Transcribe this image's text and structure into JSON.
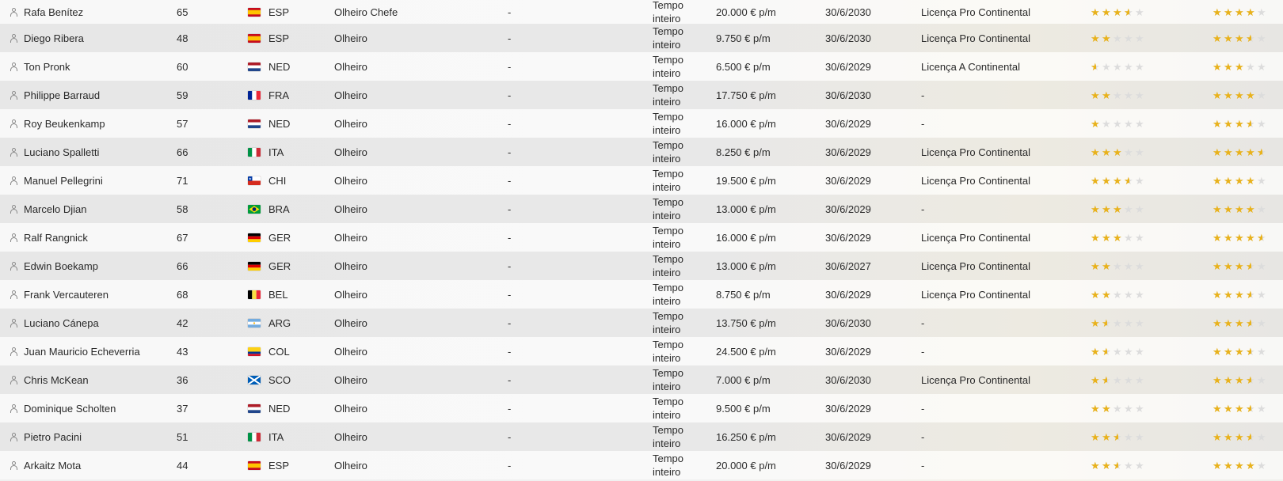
{
  "colors": {
    "star_full": "#e9b21b",
    "star_empty": "#dcdcdc",
    "text": "#2a2a2a"
  },
  "icons": {
    "row_icon": "person-icon",
    "rating_icon": "star-icon"
  },
  "staff": [
    {
      "name": "Rafa Benítez",
      "age": "65",
      "flag": "ESP",
      "nation": "ESP",
      "role": "Olheiro Chefe",
      "extra": "-",
      "contract_line1": "Tempo",
      "contract_line2": "inteiro",
      "wage": "20.000 € p/m",
      "expiry": "30/6/2030",
      "license": "Licença Pro Continental",
      "current_ability": 3.5,
      "potential_ability": 4
    },
    {
      "name": "Diego Ribera",
      "age": "48",
      "flag": "ESP",
      "nation": "ESP",
      "role": "Olheiro",
      "extra": "-",
      "contract_line1": "Tempo",
      "contract_line2": "inteiro",
      "wage": "9.750 € p/m",
      "expiry": "30/6/2030",
      "license": "Licença Pro Continental",
      "current_ability": 2,
      "potential_ability": 3.5
    },
    {
      "name": "Ton Pronk",
      "age": "60",
      "flag": "NED",
      "nation": "NED",
      "role": "Olheiro",
      "extra": "-",
      "contract_line1": "Tempo",
      "contract_line2": "inteiro",
      "wage": "6.500 € p/m",
      "expiry": "30/6/2029",
      "license": "Licença A Continental",
      "current_ability": 0.5,
      "potential_ability": 3
    },
    {
      "name": "Philippe Barraud",
      "age": "59",
      "flag": "FRA",
      "nation": "FRA",
      "role": "Olheiro",
      "extra": "-",
      "contract_line1": "Tempo",
      "contract_line2": "inteiro",
      "wage": "17.750 € p/m",
      "expiry": "30/6/2030",
      "license": "-",
      "current_ability": 2,
      "potential_ability": 4
    },
    {
      "name": "Roy Beukenkamp",
      "age": "57",
      "flag": "NED",
      "nation": "NED",
      "role": "Olheiro",
      "extra": "-",
      "contract_line1": "Tempo",
      "contract_line2": "inteiro",
      "wage": "16.000 € p/m",
      "expiry": "30/6/2029",
      "license": "-",
      "current_ability": 1,
      "potential_ability": 3.5
    },
    {
      "name": "Luciano Spalletti",
      "age": "66",
      "flag": "ITA",
      "nation": "ITA",
      "role": "Olheiro",
      "extra": "-",
      "contract_line1": "Tempo",
      "contract_line2": "inteiro",
      "wage": "8.250 € p/m",
      "expiry": "30/6/2029",
      "license": "Licença Pro Continental",
      "current_ability": 3,
      "potential_ability": 4.5
    },
    {
      "name": "Manuel Pellegrini",
      "age": "71",
      "flag": "CHI",
      "nation": "CHI",
      "role": "Olheiro",
      "extra": "-",
      "contract_line1": "Tempo",
      "contract_line2": "inteiro",
      "wage": "19.500 € p/m",
      "expiry": "30/6/2029",
      "license": "Licença Pro Continental",
      "current_ability": 3.5,
      "potential_ability": 4
    },
    {
      "name": "Marcelo Djian",
      "age": "58",
      "flag": "BRA",
      "nation": "BRA",
      "role": "Olheiro",
      "extra": "-",
      "contract_line1": "Tempo",
      "contract_line2": "inteiro",
      "wage": "13.000 € p/m",
      "expiry": "30/6/2029",
      "license": "-",
      "current_ability": 3,
      "potential_ability": 4
    },
    {
      "name": "Ralf Rangnick",
      "age": "67",
      "flag": "GER",
      "nation": "GER",
      "role": "Olheiro",
      "extra": "-",
      "contract_line1": "Tempo",
      "contract_line2": "inteiro",
      "wage": "16.000 € p/m",
      "expiry": "30/6/2029",
      "license": "Licença Pro Continental",
      "current_ability": 3,
      "potential_ability": 4.5
    },
    {
      "name": "Edwin Boekamp",
      "age": "66",
      "flag": "GER",
      "nation": "GER",
      "role": "Olheiro",
      "extra": "-",
      "contract_line1": "Tempo",
      "contract_line2": "inteiro",
      "wage": "13.000 € p/m",
      "expiry": "30/6/2027",
      "license": "Licença Pro Continental",
      "current_ability": 2,
      "potential_ability": 3.5
    },
    {
      "name": "Frank Vercauteren",
      "age": "68",
      "flag": "BEL",
      "nation": "BEL",
      "role": "Olheiro",
      "extra": "-",
      "contract_line1": "Tempo",
      "contract_line2": "inteiro",
      "wage": "8.750 € p/m",
      "expiry": "30/6/2029",
      "license": "Licença Pro Continental",
      "current_ability": 2,
      "potential_ability": 3.5
    },
    {
      "name": "Luciano Cánepa",
      "age": "42",
      "flag": "ARG",
      "nation": "ARG",
      "role": "Olheiro",
      "extra": "-",
      "contract_line1": "Tempo",
      "contract_line2": "inteiro",
      "wage": "13.750 € p/m",
      "expiry": "30/6/2030",
      "license": "-",
      "current_ability": 1.5,
      "potential_ability": 3.5
    },
    {
      "name": "Juan Mauricio Echeverria",
      "age": "43",
      "flag": "COL",
      "nation": "COL",
      "role": "Olheiro",
      "extra": "-",
      "contract_line1": "Tempo",
      "contract_line2": "inteiro",
      "wage": "24.500 € p/m",
      "expiry": "30/6/2029",
      "license": "-",
      "current_ability": 1.5,
      "potential_ability": 3.5
    },
    {
      "name": "Chris McKean",
      "age": "36",
      "flag": "SCO",
      "nation": "SCO",
      "role": "Olheiro",
      "extra": "-",
      "contract_line1": "Tempo",
      "contract_line2": "inteiro",
      "wage": "7.000 € p/m",
      "expiry": "30/6/2030",
      "license": "Licença Pro Continental",
      "current_ability": 1.5,
      "potential_ability": 3.5
    },
    {
      "name": "Dominique Scholten",
      "age": "37",
      "flag": "NED",
      "nation": "NED",
      "role": "Olheiro",
      "extra": "-",
      "contract_line1": "Tempo",
      "contract_line2": "inteiro",
      "wage": "9.500 € p/m",
      "expiry": "30/6/2029",
      "license": "-",
      "current_ability": 2,
      "potential_ability": 3.5
    },
    {
      "name": "Pietro Pacini",
      "age": "51",
      "flag": "ITA",
      "nation": "ITA",
      "role": "Olheiro",
      "extra": "-",
      "contract_line1": "Tempo",
      "contract_line2": "inteiro",
      "wage": "16.250 € p/m",
      "expiry": "30/6/2029",
      "license": "-",
      "current_ability": 2.5,
      "potential_ability": 3.5
    },
    {
      "name": "Arkaitz Mota",
      "age": "44",
      "flag": "ESP",
      "nation": "ESP",
      "role": "Olheiro",
      "extra": "-",
      "contract_line1": "Tempo",
      "contract_line2": "inteiro",
      "wage": "20.000 € p/m",
      "expiry": "30/6/2029",
      "license": "-",
      "current_ability": 2.5,
      "potential_ability": 4
    }
  ]
}
